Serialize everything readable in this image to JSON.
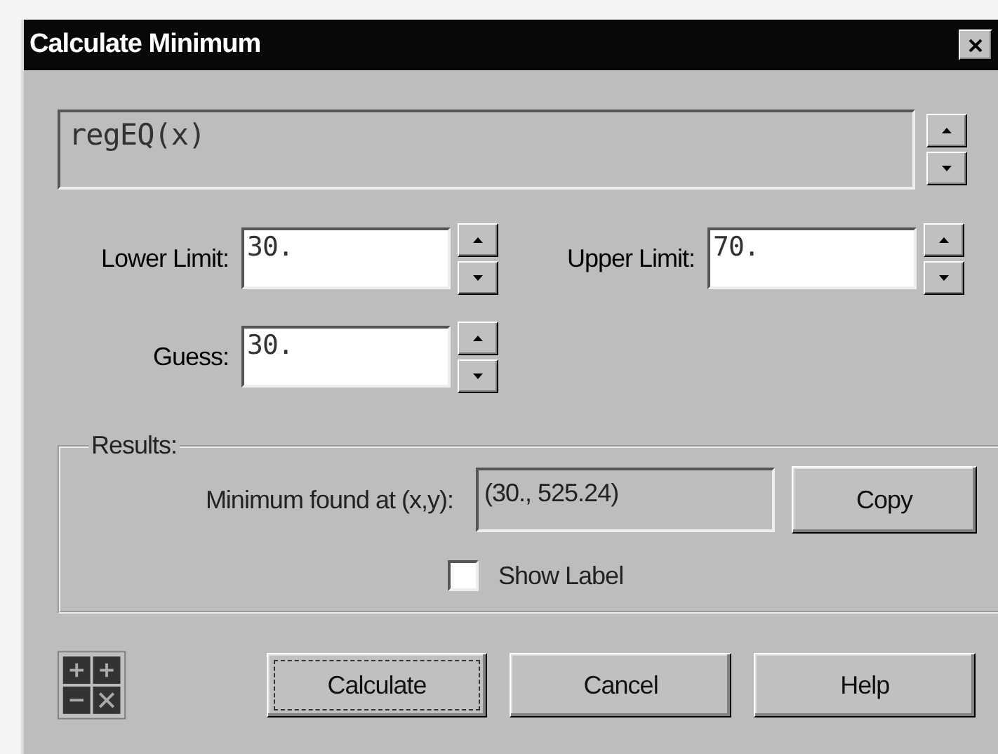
{
  "window": {
    "title": "Calculate Minimum"
  },
  "expression": {
    "value": "regEQ(x)"
  },
  "limits": [
    {
      "label": "Lower Limit:",
      "value": "30."
    },
    {
      "label": "Upper Limit:",
      "value": "70."
    }
  ],
  "guess": {
    "label": "Guess:",
    "value": "30."
  },
  "results": {
    "title": "Results:",
    "minimum_label": "Minimum found at (x,y):",
    "minimum_value": "(30., 525.24)",
    "copy_button": "Copy",
    "show_label": {
      "label": "Show Label",
      "checked": false
    }
  },
  "buttons": [
    {
      "label": "Calculate",
      "focused": true
    },
    {
      "label": "Cancel",
      "focused": false
    },
    {
      "label": "Help",
      "focused": false
    }
  ]
}
